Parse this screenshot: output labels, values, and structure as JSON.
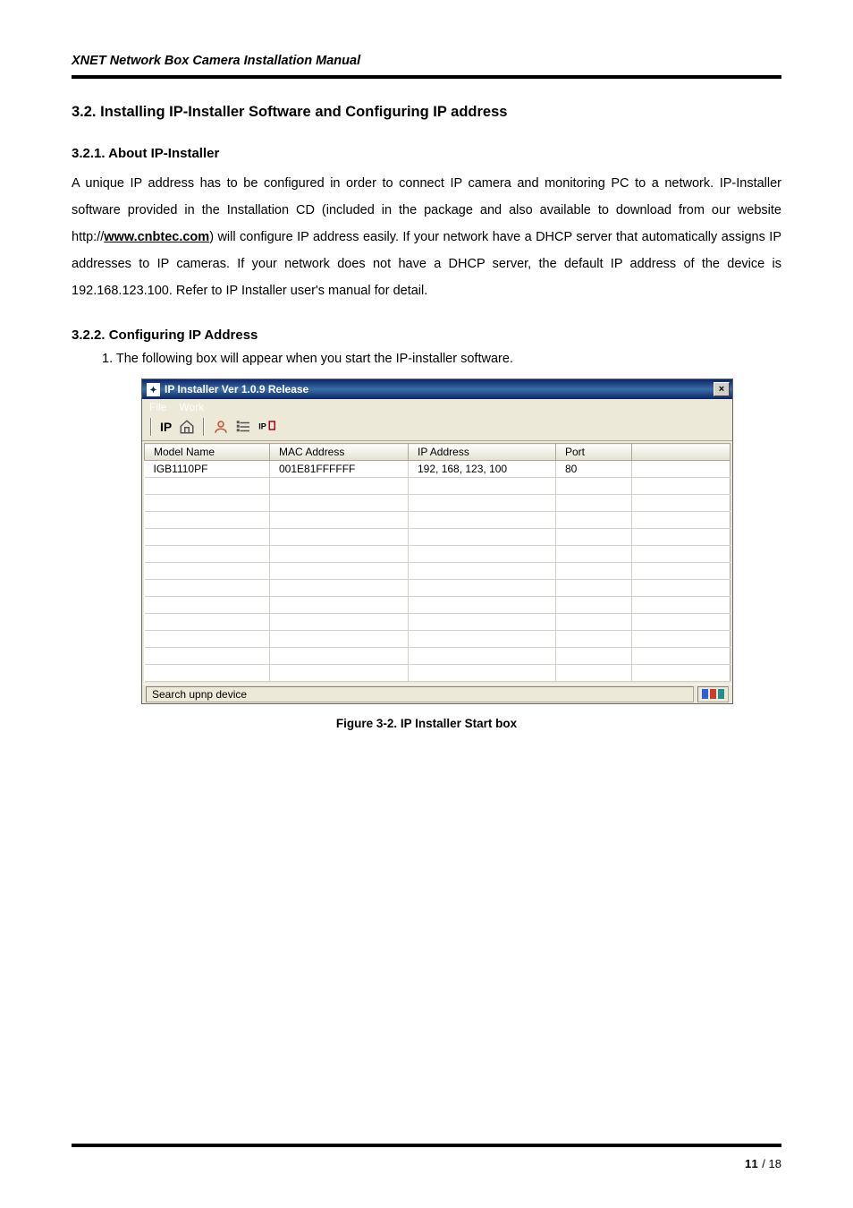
{
  "running_head": "XNET Network Box Camera Installation Manual",
  "h2": "3.2. Installing IP-Installer Software and Configuring IP address",
  "h3_1": "3.2.1. About IP-Installer",
  "para1_a": "A unique IP address has to be configured in order to connect IP camera and monitoring PC to a network. IP-Installer software provided in the Installation CD (included in the package and also available to download from our website http://",
  "para1_link": "www.cnbtec.com",
  "para1_b": ") will configure IP address easily. If your network have a DHCP server that automatically assigns IP addresses to IP cameras. If your network does not have a DHCP server, the default IP address of the device is 192.168.123.100. Refer to IP Installer user's manual for detail.",
  "h3_2": "3.2.2. Configuring IP Address",
  "step1": "1. The following box will appear when you start the IP-installer software.",
  "app": {
    "title": "IP Installer Ver 1.0.9 Release",
    "menu_file": "File",
    "menu_work": "Work",
    "toolbar_ip": "IP",
    "columns": {
      "model": "Model Name",
      "mac": "MAC Address",
      "ip": "IP Address",
      "port": "Port"
    },
    "row1": {
      "model": "IGB1110PF",
      "mac": "001E81FFFFFF",
      "ip": "192, 168, 123, 100",
      "port": "80"
    },
    "status": "Search upnp device"
  },
  "figure_caption": "Figure 3-2. IP Installer Start box",
  "page_current": "11",
  "page_sep": " / ",
  "page_total": "18"
}
